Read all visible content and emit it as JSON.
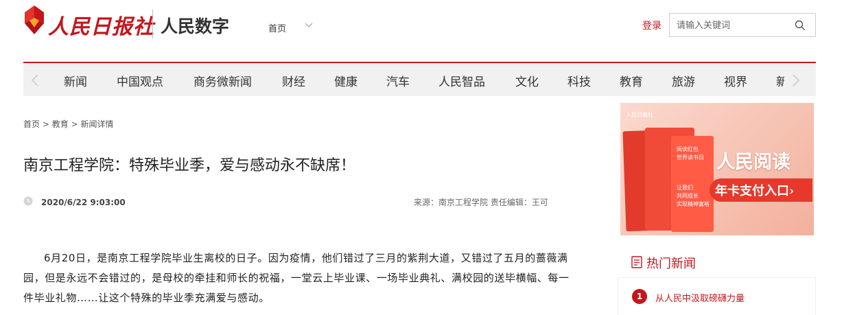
{
  "header": {
    "logo_text": "人民日报社",
    "logo_sub": "人民数字",
    "home_label": "首页",
    "login_label": "登录",
    "search_placeholder": "请输入关键词"
  },
  "nav": {
    "items": [
      "新闻",
      "中国观点",
      "商务微新闻",
      "财经",
      "健康",
      "汽车",
      "人民智品",
      "文化",
      "科技",
      "教育",
      "旅游",
      "视界",
      "新"
    ]
  },
  "breadcrumb": {
    "items": [
      "首页",
      "教育",
      "新闻详情"
    ],
    "separator": ">"
  },
  "article": {
    "title": "南京工程学院：特殊毕业季，爱与感动永不缺席！",
    "date": "2020/6/22 9:03:00",
    "source": "来源：南京工程学院 责任编辑：王可",
    "paragraph": "6月20日，是南京工程学院毕业生离校的日子。因为疫情，他们错过了三月的紫荆大道，又错过了五月的蔷薇满园，但是永远不会错过的，是母校的牵挂和师长的祝福，一堂云上毕业课、一场毕业典礼、满校园的送毕横幅、每一件毕业礼物……让这个特殊的毕业季充满爱与感动。"
  },
  "sidebar": {
    "ad": {
      "headline": "人民阅读",
      "button": "年卡支付入口›",
      "line1": "阅读红包",
      "line2": "世界读书日",
      "line3": "让我们",
      "line4": "共同成长",
      "line5": "实现精神富裕"
    },
    "hot": {
      "title": "热门新闻",
      "items": [
        {
          "rank": "1",
          "text": "从人民中汲取磅礴力量"
        }
      ]
    }
  },
  "colors": {
    "brand_red": "#c4161c",
    "nav_bg": "#f1f1f1"
  }
}
